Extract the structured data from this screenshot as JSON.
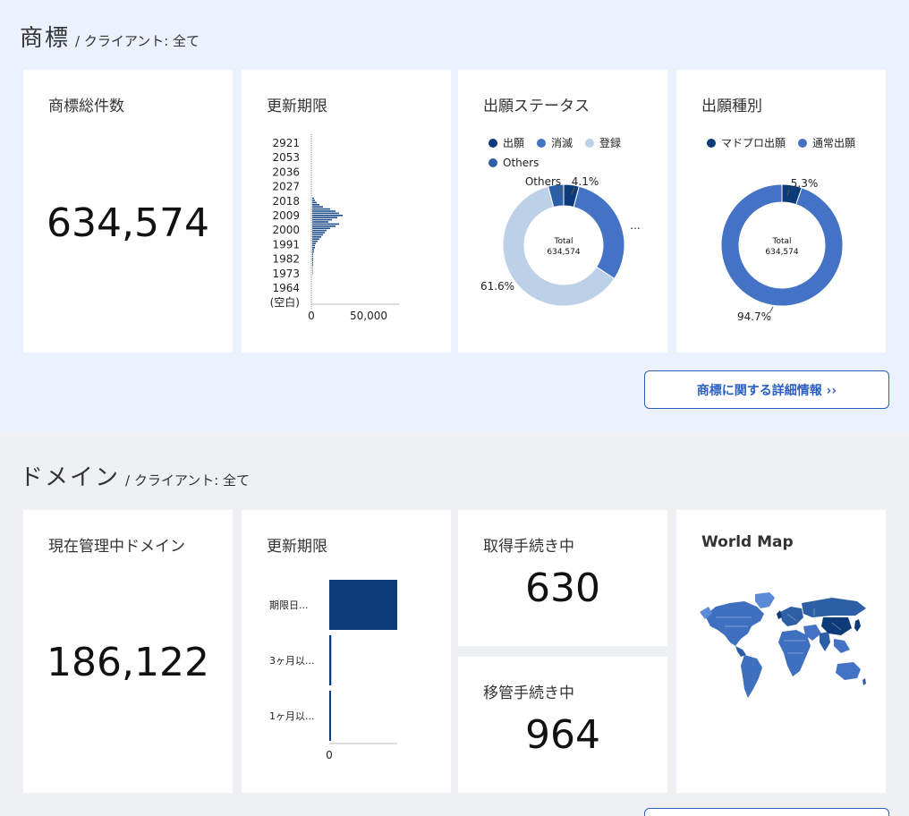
{
  "trademark": {
    "title": "商標",
    "subtitle": "/ クライアント: 全て",
    "total": {
      "label": "商標総件数",
      "value": "634,574"
    },
    "renewal": {
      "label": "更新期限",
      "y_labels": [
        "2921",
        "2053",
        "2036",
        "2027",
        "2018",
        "2009",
        "2000",
        "1991",
        "1982",
        "1973",
        "1964",
        "(空白)"
      ],
      "x_ticks": [
        "0",
        "50,000"
      ]
    },
    "status": {
      "label": "出願ステータス",
      "legend": [
        {
          "name": "出願",
          "color": "#0d3b7a"
        },
        {
          "name": "消滅",
          "color": "#4472c4"
        },
        {
          "name": "登録",
          "color": "#bcd0e8"
        },
        {
          "name": "Others",
          "color": "#2d5fa6"
        }
      ],
      "center_label": "Total",
      "center_value": "634,574",
      "annotations": {
        "others": "Others",
        "others_pct": "4.1%",
        "ellipsis": "...",
        "registered_pct": "61.6%"
      }
    },
    "type": {
      "label": "出願種別",
      "legend": [
        {
          "name": "マドプロ出願",
          "color": "#0d3b7a"
        },
        {
          "name": "通常出願",
          "color": "#4472c4"
        }
      ],
      "center_label": "Total",
      "center_value": "634,574",
      "annotations": {
        "small_pct": "5.3%",
        "large_pct": "94.7%"
      }
    },
    "detail_button": "商標に関する詳細情報 ››"
  },
  "domain": {
    "title": "ドメイン",
    "subtitle": "/ クライアント: 全て",
    "managed": {
      "label": "現在管理中ドメイン",
      "value": "186,122"
    },
    "renewal": {
      "label": "更新期限",
      "rows": [
        "期限日...",
        "3ヶ月以...",
        "1ヶ月以..."
      ],
      "x_tick": "0"
    },
    "acquiring": {
      "label": "取得手続き中",
      "value": "630"
    },
    "transferring": {
      "label": "移管手続き中",
      "value": "964"
    },
    "world_map": {
      "label": "World Map"
    }
  },
  "chart_data": [
    {
      "type": "bar",
      "orientation": "horizontal",
      "title": "更新期限",
      "categories": [
        "2921",
        "2053",
        "2036",
        "2027",
        "2018",
        "2009",
        "2000",
        "1991",
        "1982",
        "1973",
        "1964",
        "(空白)"
      ],
      "xlim": [
        0,
        100000
      ],
      "x_ticks": [
        0,
        50000
      ]
    },
    {
      "type": "pie",
      "title": "出願ステータス",
      "labels": [
        "出願",
        "消滅",
        "登録",
        "Others"
      ],
      "values": [
        4.1,
        30.2,
        61.6,
        4.1
      ],
      "total": 634574
    },
    {
      "type": "pie",
      "title": "出願種別",
      "labels": [
        "マドプロ出願",
        "通常出願"
      ],
      "values": [
        5.3,
        94.7
      ],
      "total": 634574
    },
    {
      "type": "bar",
      "orientation": "horizontal",
      "title": "更新期限",
      "categories": [
        "期限日...",
        "3ヶ月以...",
        "1ヶ月以..."
      ],
      "values": [
        100,
        3,
        1
      ]
    }
  ]
}
